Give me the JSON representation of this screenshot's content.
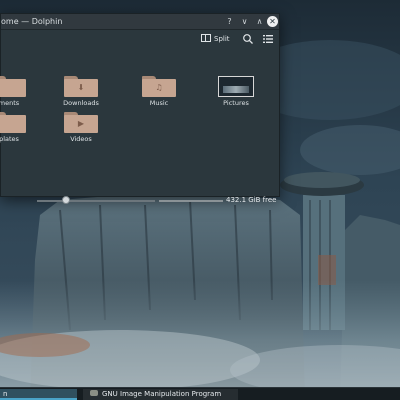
{
  "window": {
    "title": "ome — Dolphin",
    "help_glyph": "?",
    "minimize_glyph": "∨",
    "maximize_glyph": "∧",
    "close_glyph": "✕"
  },
  "toolbar": {
    "split_label": "Split"
  },
  "items": [
    {
      "label": "ments",
      "glyph": ""
    },
    {
      "label": "Downloads",
      "glyph": "⬇"
    },
    {
      "label": "Music",
      "glyph": "♫"
    },
    {
      "label": "Pictures",
      "glyph": ""
    },
    {
      "label": "plates",
      "glyph": ""
    },
    {
      "label": "Videos",
      "glyph": "▶"
    }
  ],
  "status": {
    "free_space": "432.1 GiB free"
  },
  "taskbar": {
    "dolphin_label": "n",
    "gimp_label": "GNU Image Manipulation Program"
  },
  "icons": {
    "folder_color": "#c6a591",
    "accent": "#4aa3c8"
  }
}
